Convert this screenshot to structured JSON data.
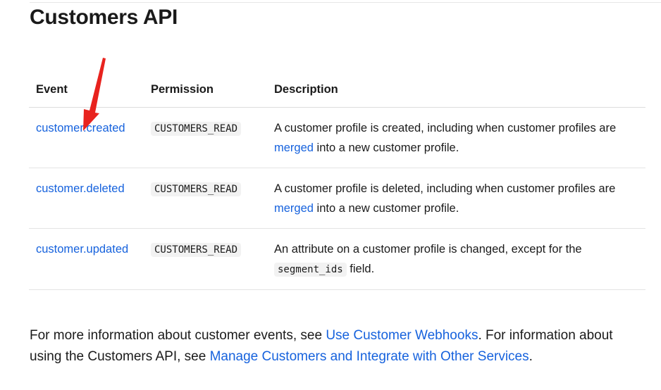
{
  "page": {
    "title": "Customers API"
  },
  "table": {
    "headers": {
      "event": "Event",
      "permission": "Permission",
      "description": "Description"
    },
    "rows": [
      {
        "event": "customer.created",
        "permission": "CUSTOMERS_READ",
        "desc_before": "A customer profile is created, including when customer profiles are ",
        "desc_link": "merged",
        "desc_after": " into a new customer profile."
      },
      {
        "event": "customer.deleted",
        "permission": "CUSTOMERS_READ",
        "desc_before": "A customer profile is deleted, including when customer profiles are ",
        "desc_link": "merged",
        "desc_after": " into a new customer profile."
      },
      {
        "event": "customer.updated",
        "permission": "CUSTOMERS_READ",
        "desc_before": "An attribute on a customer profile is changed, except for the ",
        "desc_code": "segment_ids",
        "desc_after": " field."
      }
    ]
  },
  "footer": {
    "text1": "For more information about customer events, see ",
    "link1": "Use Customer Webhooks",
    "text2": ". For information about using the Customers API, see ",
    "link2": "Manage Customers and Integrate with Other Services",
    "text3": "."
  },
  "colors": {
    "link": "#1662dd",
    "annotation_arrow": "#e8231e"
  }
}
